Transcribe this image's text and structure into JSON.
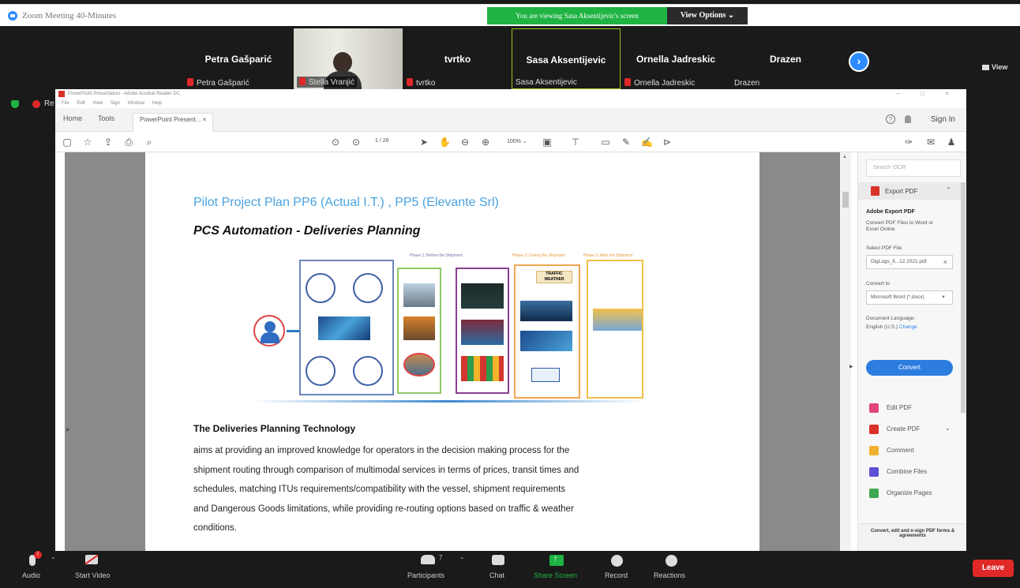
{
  "zoom": {
    "window_title": "Zoom Meeting 40-Minutes",
    "viewing_badge": "You are viewing Sasa Aksentijevic's screen",
    "view_options": "View Options ⌄",
    "view_button": "View",
    "recording_label": "Re"
  },
  "participants": [
    {
      "name": "Petra Gašparić",
      "label": "Petra Gašparić",
      "muted": true
    },
    {
      "name": "",
      "label": "Stella Vranjić",
      "muted": true,
      "video": true
    },
    {
      "name": "tvrtko",
      "label": "tvrtko",
      "muted": true
    },
    {
      "name": "Sasa Aksentijevic",
      "label": "Sasa Aksentijevic",
      "muted": false,
      "active": true
    },
    {
      "name": "Ornella Jadreskic",
      "label": "Ornella Jadreskic",
      "muted": true
    },
    {
      "name": "Drazen",
      "label": "Drazen",
      "muted": false
    }
  ],
  "acrobat": {
    "title": "PowerPoint Presentation - Adobe Acrobat Reader DC",
    "menu": [
      "File",
      "Edit",
      "View",
      "Sign",
      "Window",
      "Help"
    ],
    "tabs": {
      "home": "Home",
      "tools": "Tools",
      "doc": "PowerPoint Present... ×"
    },
    "sign_in": "Sign In",
    "page_indicator": "1  / 26",
    "zoom_level": "100% ⌄",
    "right_pane": {
      "search_placeholder": "Search 'OCR'",
      "export_pdf": "Export PDF",
      "adobe_export_title": "Adobe Export PDF",
      "convert_desc": "Convert PDF Files to Word or Excel Online",
      "select_file_label": "Select PDF File",
      "selected_file": "DigLogs_fi...12.2021.pdf",
      "convert_to_label": "Convert to",
      "convert_to_value": "Microsoft Word (*.docx)",
      "doc_lang_label": "Document Language:",
      "doc_lang_value": "English (U.S.)",
      "change_link": "Change",
      "convert_button": "Convert",
      "tools": [
        "Edit PDF",
        "Create PDF",
        "Comment",
        "Combine Files",
        "Organize Pages"
      ],
      "bottom_promo": "Convert, edit and e-sign PDF forms & agreements"
    }
  },
  "slide": {
    "title": "Pilot Project Plan PP6 (Actual I.T.) , PP5 (Elevante Srl)",
    "subtitle": "PCS Automation - Deliveries Planning",
    "diagram": {
      "phase1": "Phase 1: Before the Shipment",
      "phase2": "Phase 2: During the Shipment",
      "phase3": "Phase 3: After the Shipment",
      "traffic": "TRAFFIC WEATHER"
    },
    "heading": "The Deliveries Planning Technology",
    "paragraph_lines": [
      "aims at providing an improved knowledge for operators in the decision making process for the",
      "shipment routing through comparison of multimodal services in terms of prices, transit times and",
      "schedules, matching ITUs requirements/compatibility with the vessel, shipment requirements",
      "and Dangerous Goods limitations, while providing re-routing options based on traffic & weather",
      "conditions."
    ]
  },
  "bottombar": {
    "audio": "Audio",
    "audio_badge": "!",
    "start_video": "Start Video",
    "participants": "Participants",
    "participants_count": "7",
    "chat": "Chat",
    "share_screen": "Share Screen",
    "record": "Record",
    "reactions": "Reactions",
    "leave": "Leave"
  }
}
